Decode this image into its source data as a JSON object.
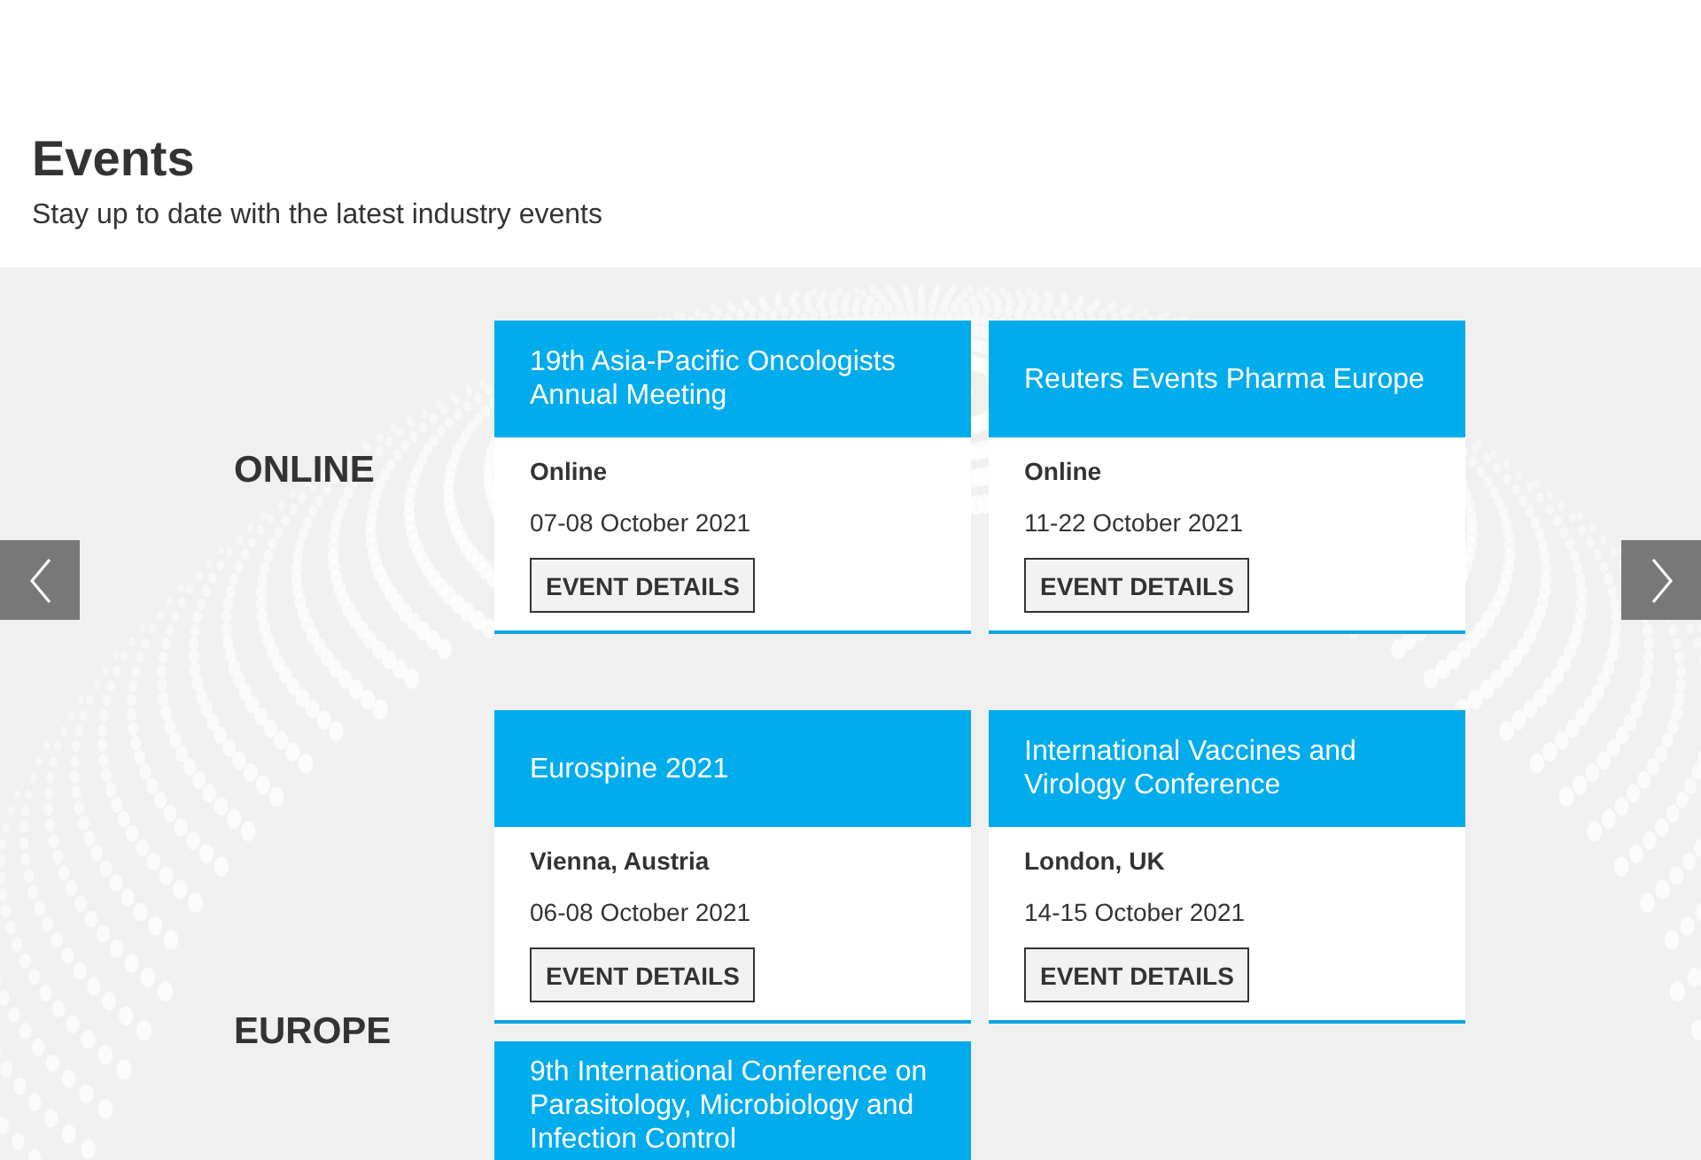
{
  "page_header": {
    "title": "Events",
    "subtitle": "Stay up to date with the latest industry events"
  },
  "carousel": {
    "regions": [
      {
        "name": "ONLINE",
        "events": [
          {
            "title": "19th Asia-Pacific Oncologists Annual Meeting",
            "location": "Online",
            "date": "07-08 October 2021",
            "button": "EVENT DETAILS"
          },
          {
            "title": "Reuters Events Pharma Europe",
            "location": "Online",
            "date": "11-22 October 2021",
            "button": "EVENT DETAILS"
          }
        ]
      },
      {
        "name": "EUROPE",
        "events": [
          {
            "title": "Eurospine 2021",
            "location": "Vienna, Austria",
            "date": "06-08 October 2021",
            "button": "EVENT DETAILS"
          },
          {
            "title": "International Vaccines and Virology Conference",
            "location": "London, UK",
            "date": "14-15 October 2021",
            "button": "EVENT DETAILS"
          },
          {
            "title": "9th International Conference on Parasitology, Microbiology and Infection Control"
          }
        ]
      }
    ]
  }
}
